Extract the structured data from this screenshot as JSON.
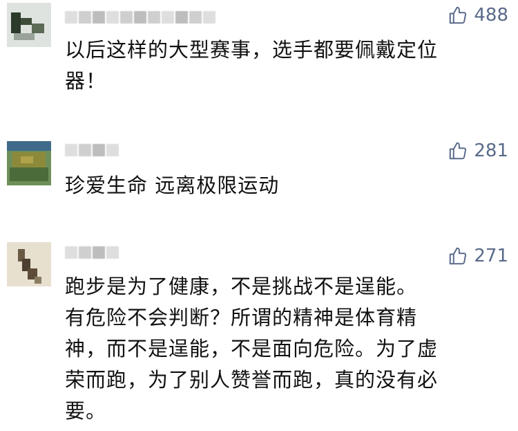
{
  "comments": [
    {
      "likes": "488",
      "text": "以后这样的大型赛事，选手都要佩戴定位\n器！"
    },
    {
      "likes": "281",
      "text": "珍爱生命 远离极限运动"
    },
    {
      "likes": "271",
      "text": "跑步是为了健康，不是挑战不是逞能。\n有危险不会判断？所谓的精神是体育精\n神，而不是逞能，不是面向危险。为了虚\n荣而跑，为了别人赞誉而跑，真的没有必\n要。"
    }
  ],
  "icons": {
    "like": "thumbs-up-icon"
  },
  "colors": {
    "like_count": "#5a6a8a",
    "text": "#111111",
    "background": "#ffffff"
  }
}
